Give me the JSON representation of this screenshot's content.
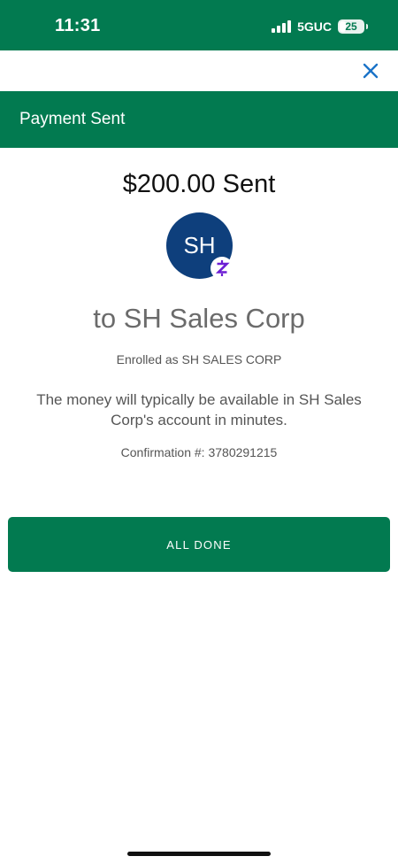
{
  "status_bar": {
    "time": "11:31",
    "network": "5GUC",
    "battery_level": "25",
    "battery_fraction": 0.25
  },
  "header": {
    "close_icon": "close-icon",
    "title": "Payment Sent"
  },
  "payment": {
    "amount_text": "$200.00 Sent",
    "avatar_initials": "SH",
    "badge_icon": "zelle-icon",
    "recipient_text": "to SH Sales Corp",
    "enrolled_text": "Enrolled as SH SALES CORP",
    "availability_message": "The money will typically be available in SH Sales Corp's account in minutes.",
    "confirmation_label": "Confirmation #:",
    "confirmation_number": "3780291215"
  },
  "actions": {
    "done_label": "ALL DONE"
  },
  "colors": {
    "brand_green": "#027a50",
    "avatar_blue": "#0e3f7c",
    "close_blue": "#1a73c8",
    "zelle_purple": "#6d1ed4"
  }
}
